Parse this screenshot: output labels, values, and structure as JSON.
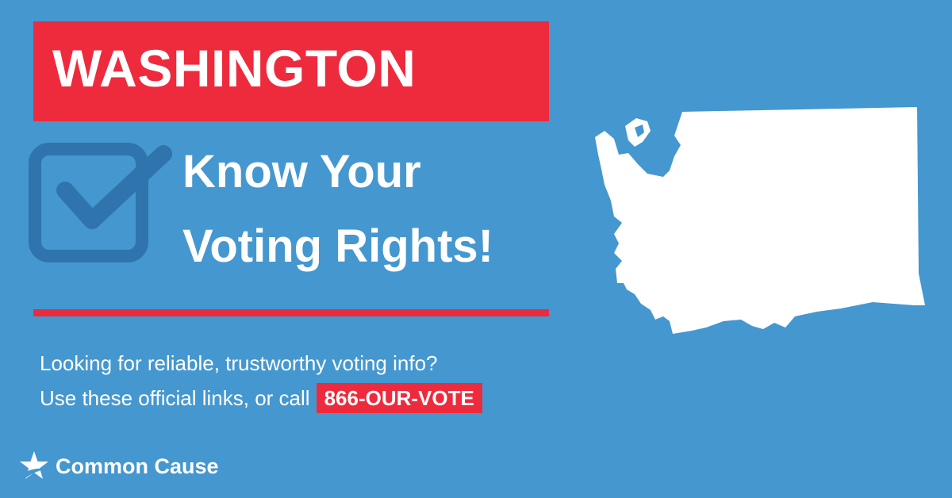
{
  "banner": {
    "state": "WASHINGTON"
  },
  "headline": {
    "line1": "Know Your",
    "line2": "Voting Rights!"
  },
  "info": {
    "line1": "Looking for reliable, trustworthy voting info?",
    "line2": "Use these official links, or call",
    "phone": "866-OUR-VOTE"
  },
  "brand": {
    "name": "Common Cause",
    "icon": "star-icon"
  },
  "icons": {
    "checkbox": "checkbox-checked-icon",
    "map": "washington-state-map-icon"
  },
  "colors": {
    "background": "#4597cf",
    "accent_red": "#ee2a3d",
    "icon_dark_blue": "#2f74ad",
    "text": "#ffffff"
  }
}
